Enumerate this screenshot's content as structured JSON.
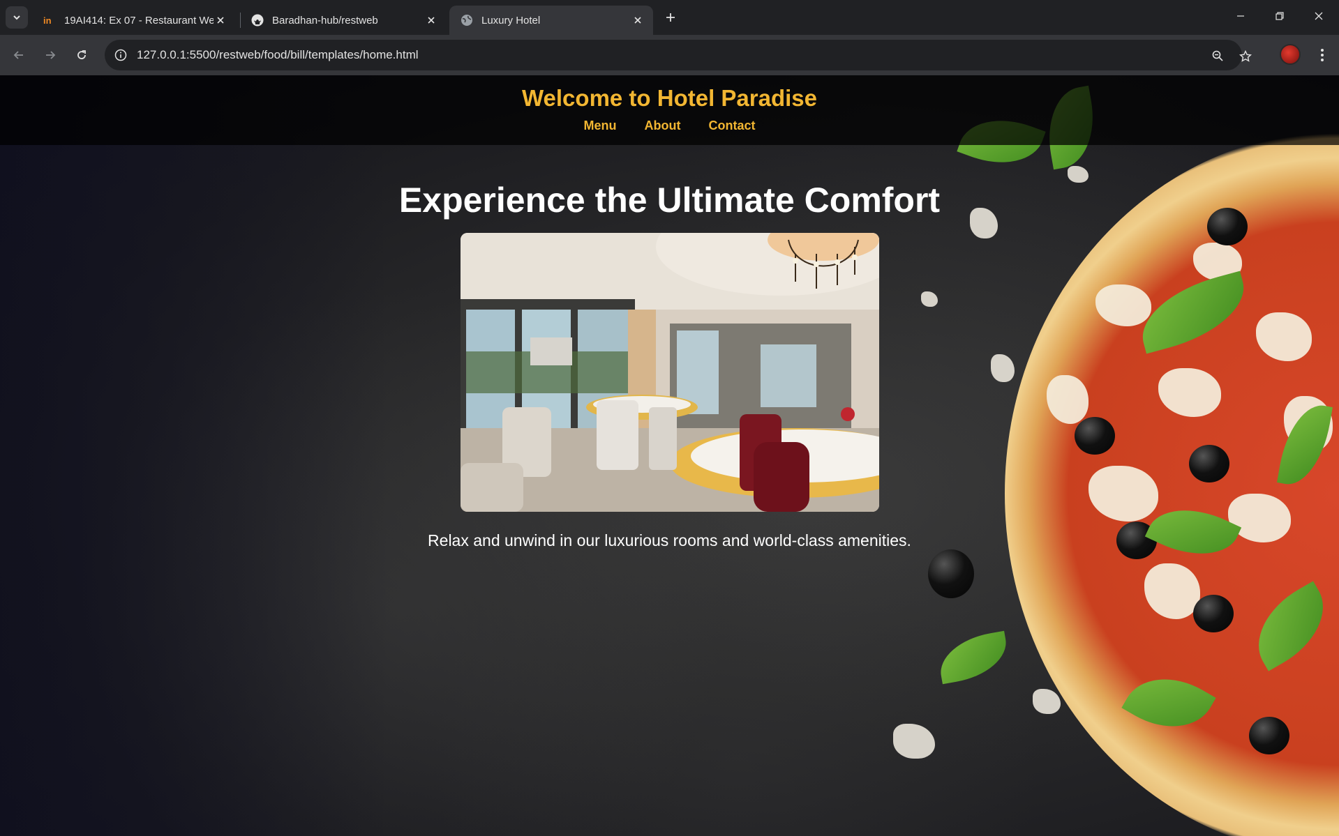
{
  "browser": {
    "tabs": [
      {
        "title": "19AI414: Ex 07 - Restaurant We",
        "favicon": "invision-icon",
        "active": false
      },
      {
        "title": "Baradhan-hub/restweb",
        "favicon": "github-icon",
        "active": false
      },
      {
        "title": "Luxury Hotel",
        "favicon": "globe-icon",
        "active": true
      }
    ],
    "url": "127.0.0.1:5500/restweb/food/bill/templates/home.html"
  },
  "site": {
    "title": "Welcome to Hotel Paradise",
    "nav": [
      "Menu",
      "About",
      "Contact"
    ],
    "hero_title": "Experience the Ultimate Comfort",
    "hero_text": "Relax and unwind in our luxurious rooms and world-class amenities."
  },
  "colors": {
    "accent": "#f2b632",
    "chrome_dark": "#202124",
    "chrome_toolbar": "#35363a"
  }
}
